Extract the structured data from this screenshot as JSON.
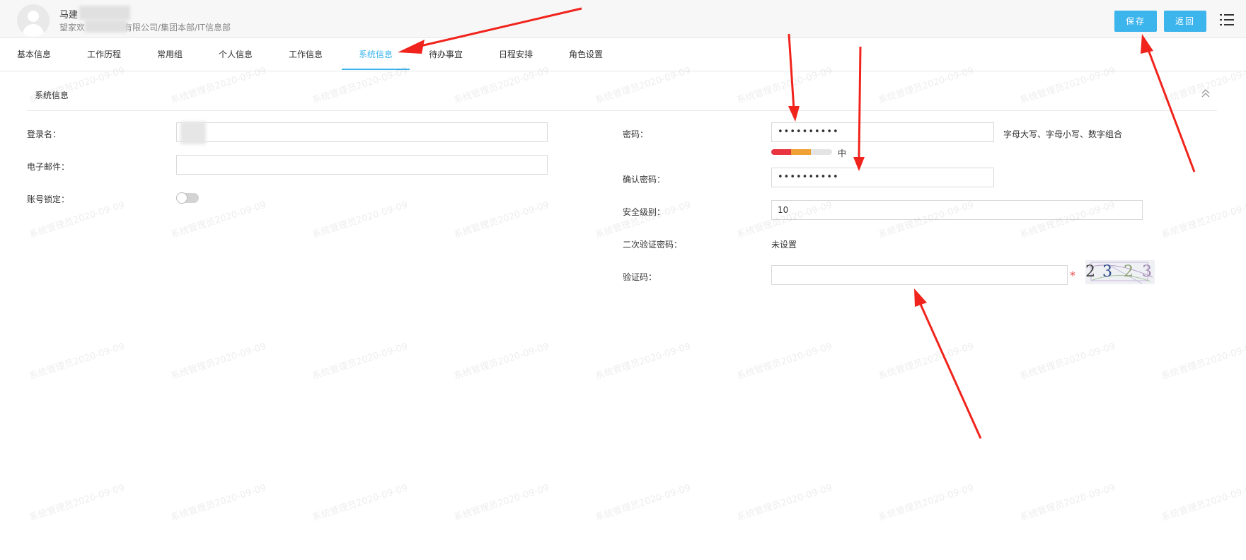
{
  "header": {
    "user_name": "马建",
    "user_org_prefix": "望家欢",
    "user_org_suffix": "有限公司/集团本部/IT信息部",
    "save_label": "保存",
    "back_label": "返回",
    "menu_icon": "list-menu-icon",
    "avatar_icon": "user-avatar-icon"
  },
  "tabs": [
    {
      "label": "基本信息"
    },
    {
      "label": "工作历程"
    },
    {
      "label": "常用组"
    },
    {
      "label": "个人信息"
    },
    {
      "label": "工作信息"
    },
    {
      "label": "系统信息",
      "active": true
    },
    {
      "label": "待办事宜"
    },
    {
      "label": "日程安排"
    },
    {
      "label": "角色设置"
    }
  ],
  "section": {
    "title": "系统信息",
    "collapse_icon": "chevron-up-icon"
  },
  "form": {
    "login_name": {
      "label": "登录名："
    },
    "email": {
      "label": "电子邮件：",
      "value": ""
    },
    "account_lock": {
      "label": "账号锁定：",
      "enabled": false
    },
    "password": {
      "label": "密码：",
      "value": "••••••••••",
      "hint": "字母大写、字母小写、数字组合"
    },
    "strength": {
      "text": "中",
      "level": "medium",
      "colors": [
        "#e8343f",
        "#f0a133",
        "#e4e4e4"
      ]
    },
    "confirm_password": {
      "label": "确认密码：",
      "value": "••••••••••"
    },
    "security_level": {
      "label": "安全级别：",
      "value": "10"
    },
    "second_auth": {
      "label": "二次验证密码：",
      "value": "未设置"
    },
    "captcha": {
      "label": "验证码：",
      "value": "",
      "required_mark": "*",
      "code": [
        "2",
        "3",
        "2",
        "3"
      ]
    }
  },
  "watermark": {
    "text": "系统管理员2020-09-09"
  },
  "colors": {
    "accent": "#3cb4ec",
    "arrow": "#f0241c"
  }
}
